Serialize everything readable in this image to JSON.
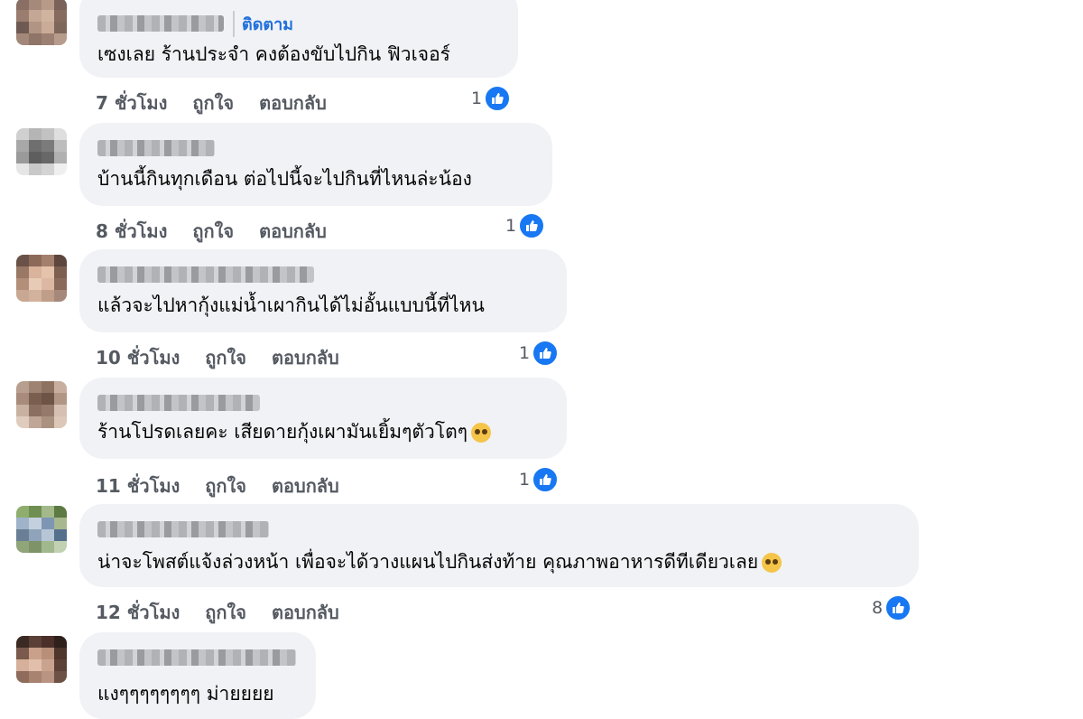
{
  "comments": [
    {
      "follow_label": "ติดตาม",
      "text": "เซงเลย ร้านประจำ คงต้องขับไปกิน ฟิวเจอร์",
      "time": "7 ชั่วโมง",
      "like_label": "ถูกใจ",
      "reply_label": "ตอบกลับ",
      "like_count": "1",
      "avatar_colors": [
        "#8a6f64",
        "#a58a7c",
        "#b89a88",
        "#7a625a",
        "#9b7d70",
        "#c4a794",
        "#d1b4a0",
        "#876a5e",
        "#6e5a52",
        "#b19483",
        "#c9ab98",
        "#7f665b",
        "#a38879",
        "#8f7468",
        "#9c8173",
        "#b79c8c"
      ]
    },
    {
      "text": "บ้านนี้กินทุกเดือน ต่อไปนี้จะไปกินที่ไหนล่ะน้อง",
      "time": "8 ชั่วโมง",
      "like_label": "ถูกใจ",
      "reply_label": "ตอบกลับ",
      "like_count": "1",
      "avatar_colors": [
        "#d0d0d0",
        "#b5b5b5",
        "#c2c2c2",
        "#dedede",
        "#a8a8a8",
        "#6f6f6f",
        "#7b7b7b",
        "#bdbdbd",
        "#9a9a9a",
        "#5e5e5e",
        "#686868",
        "#b0b0b0",
        "#e6e6e6",
        "#c9c9c9",
        "#d4d4d4",
        "#efefef"
      ]
    },
    {
      "text": "แล้วจะไปหากุ้งแม่น้ำเผากินได้ไม่อั้นแบบนี้ที่ไหน",
      "time": "10 ชั่วโมง",
      "like_label": "ถูกใจ",
      "reply_label": "ตอบกลับ",
      "like_count": "1",
      "avatar_colors": [
        "#6b5248",
        "#8c6a5a",
        "#a4806c",
        "#5c463d",
        "#9a7866",
        "#d9b39c",
        "#e4c2ab",
        "#7d5f51",
        "#b38f7a",
        "#e8cbb6",
        "#dcb8a2",
        "#8a6a5b",
        "#c9a893",
        "#d3b29d",
        "#bf9d88",
        "#a6887a"
      ]
    },
    {
      "text": "ร้านโปรดเลยคะ เสียดายกุ้งเผามันเยิ้มๆตัวโตๆ",
      "time": "11 ชั่วโมง",
      "like_label": "ถูกใจ",
      "reply_label": "ตอบกลับ",
      "like_count": "1",
      "emoji": "pleading-face",
      "avatar_colors": [
        "#b89e8e",
        "#9e8272",
        "#8d7262",
        "#c7ae9f",
        "#a88b7a",
        "#7a5f51",
        "#6d5446",
        "#b29685",
        "#c9b1a2",
        "#8b6f60",
        "#957a6b",
        "#d6c0b2",
        "#e0ccbf",
        "#c0a696",
        "#ab917f",
        "#ddc7b9"
      ]
    },
    {
      "text": "น่าจะโพสต์แจ้งล่วงหน้า เพื่อจะได้วางแผนไปกินส่งท้าย คุณภาพอาหารดีทีเดียวเลย",
      "time": "12 ชั่วโมง",
      "like_label": "ถูกใจ",
      "reply_label": "ตอบกลับ",
      "like_count": "8",
      "emoji": "pleading-face",
      "avatar_colors": [
        "#8fae6e",
        "#6f8f52",
        "#a3b98a",
        "#5d7a45",
        "#9fb3c9",
        "#c4d0dd",
        "#7d96b3",
        "#a7b88f",
        "#6a7f95",
        "#8fa4bb",
        "#b7c6d6",
        "#55708d",
        "#91a57a",
        "#7e9468",
        "#a1b78d",
        "#c3d1b3"
      ]
    },
    {
      "text": "แงๆๆๆๆๆๆๆๆ ม่ายยยย",
      "avatar_colors": [
        "#3b2a24",
        "#5a4036",
        "#4a3029",
        "#2e211c",
        "#7a5a4c",
        "#c9a08a",
        "#b88f79",
        "#4e362d",
        "#d6b09b",
        "#e2bfaa",
        "#caa38e",
        "#5c4136",
        "#8e6b5b",
        "#a88370",
        "#b99482",
        "#6d5145"
      ]
    }
  ]
}
